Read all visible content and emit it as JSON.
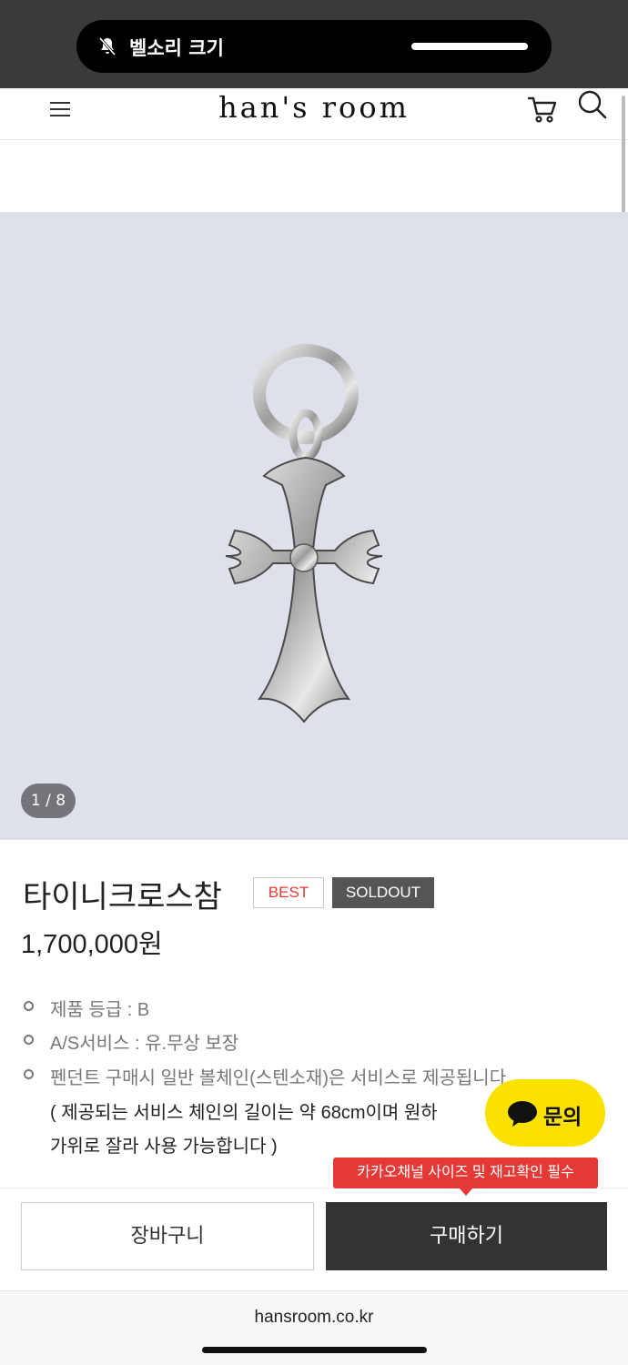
{
  "status": {
    "notification_label": "벨소리 크기"
  },
  "header": {
    "logo": "han's room"
  },
  "gallery": {
    "counter": "1 / 8"
  },
  "product": {
    "title": "타이니크로스참",
    "badge_best": "BEST",
    "badge_soldout": "SOLDOUT",
    "price": "1,700,000원",
    "specs": [
      "제품 등급 : B",
      "A/S서비스 :  유.무상 보장",
      "펜던트 구매시 일반 볼체인(스텐소재)은 서비스로 제공됩니다"
    ],
    "note_lines": [
      "( 제공되는 서비스 체인의 길이는 약 68cm이며 원하",
      "가위로 잘라 사용 가능합니다 )"
    ]
  },
  "chat": {
    "label": "문의"
  },
  "actions": {
    "tooltip": "카카오채널 사이즈 및 재고확인 필수",
    "cart_label": "장바구니",
    "buy_label": "구매하기"
  },
  "browser": {
    "url": "hansroom.co.kr"
  },
  "colors": {
    "accent_red": "#e53935",
    "kakao_yellow": "#fae100",
    "dark_button": "#333333",
    "image_bg": "#dfe1ea"
  }
}
